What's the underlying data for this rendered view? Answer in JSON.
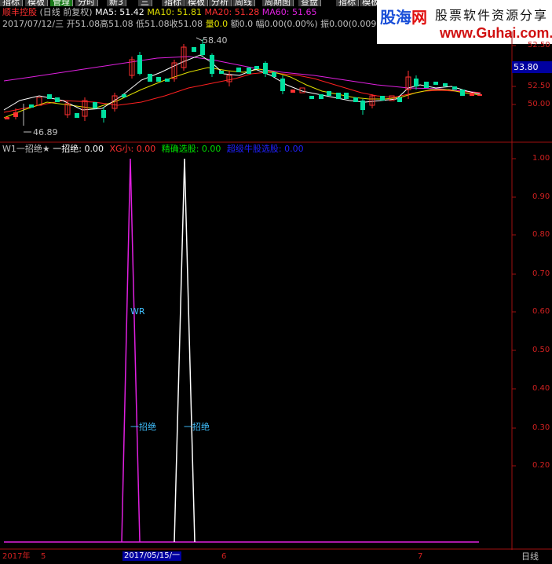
{
  "toolbar": {
    "items": [
      "指标",
      "模板",
      "管理",
      "分时",
      "新3",
      "三",
      "指标",
      "模板",
      "分析",
      "周线",
      "周期图",
      "查盘",
      "指标",
      "模板"
    ]
  },
  "header": {
    "stock_name": "顺丰控股",
    "period": "(日线 前复权)",
    "ma5": "MA5: 51.42",
    "ma10": "MA10: 51.81",
    "ma20": "MA20: 51.28",
    "ma60": "MA60: 51.65",
    "info_date": "2017/07/12/三",
    "info_open": "开51.08",
    "info_high": "高51.08",
    "info_low": "低51.08",
    "info_close": "收51.08",
    "info_vol": "量0.0",
    "info_amount": "额0.0",
    "info_range": "幅0.00(0.00%)",
    "info_amp": "振0.00(0.009"
  },
  "watermark": {
    "brand_part1": "股海",
    "brand_part2": "网",
    "tagline": "股票软件资源分享",
    "url": "www.Guhai.com.cn"
  },
  "main_chart": {
    "high_label": "58.40",
    "low_label": "46.89",
    "current_price": "53.80",
    "y_ticks": [
      "52.50",
      "52.50",
      "50.00"
    ],
    "colors": {
      "up": "#ff3030",
      "down": "#00e0a0",
      "ma5": "#ffffff",
      "ma10": "#e0e000",
      "ma20": "#ff2020",
      "ma60": "#e020e0"
    }
  },
  "indicator": {
    "name": "W1一招绝★",
    "v_yizhaojue": "一招绝: 0.00",
    "v_xg": "XG小: 0.00",
    "v_jingque": "精确选股: 0.00",
    "v_niugu": "超级牛股选股: 0.00",
    "label_wr": "WR",
    "label_yz1": "一招绝",
    "label_yz2": "一招绝",
    "y_ticks": [
      "1.00",
      "0.90",
      "0.80",
      "0.70",
      "0.60",
      "0.50",
      "0.40",
      "0.30",
      "0.20"
    ]
  },
  "bottom": {
    "year": "2017年",
    "month5": "5",
    "date_cursor": "2017/05/15/一",
    "month6": "6",
    "month7": "7",
    "period_btn": "日线"
  }
}
